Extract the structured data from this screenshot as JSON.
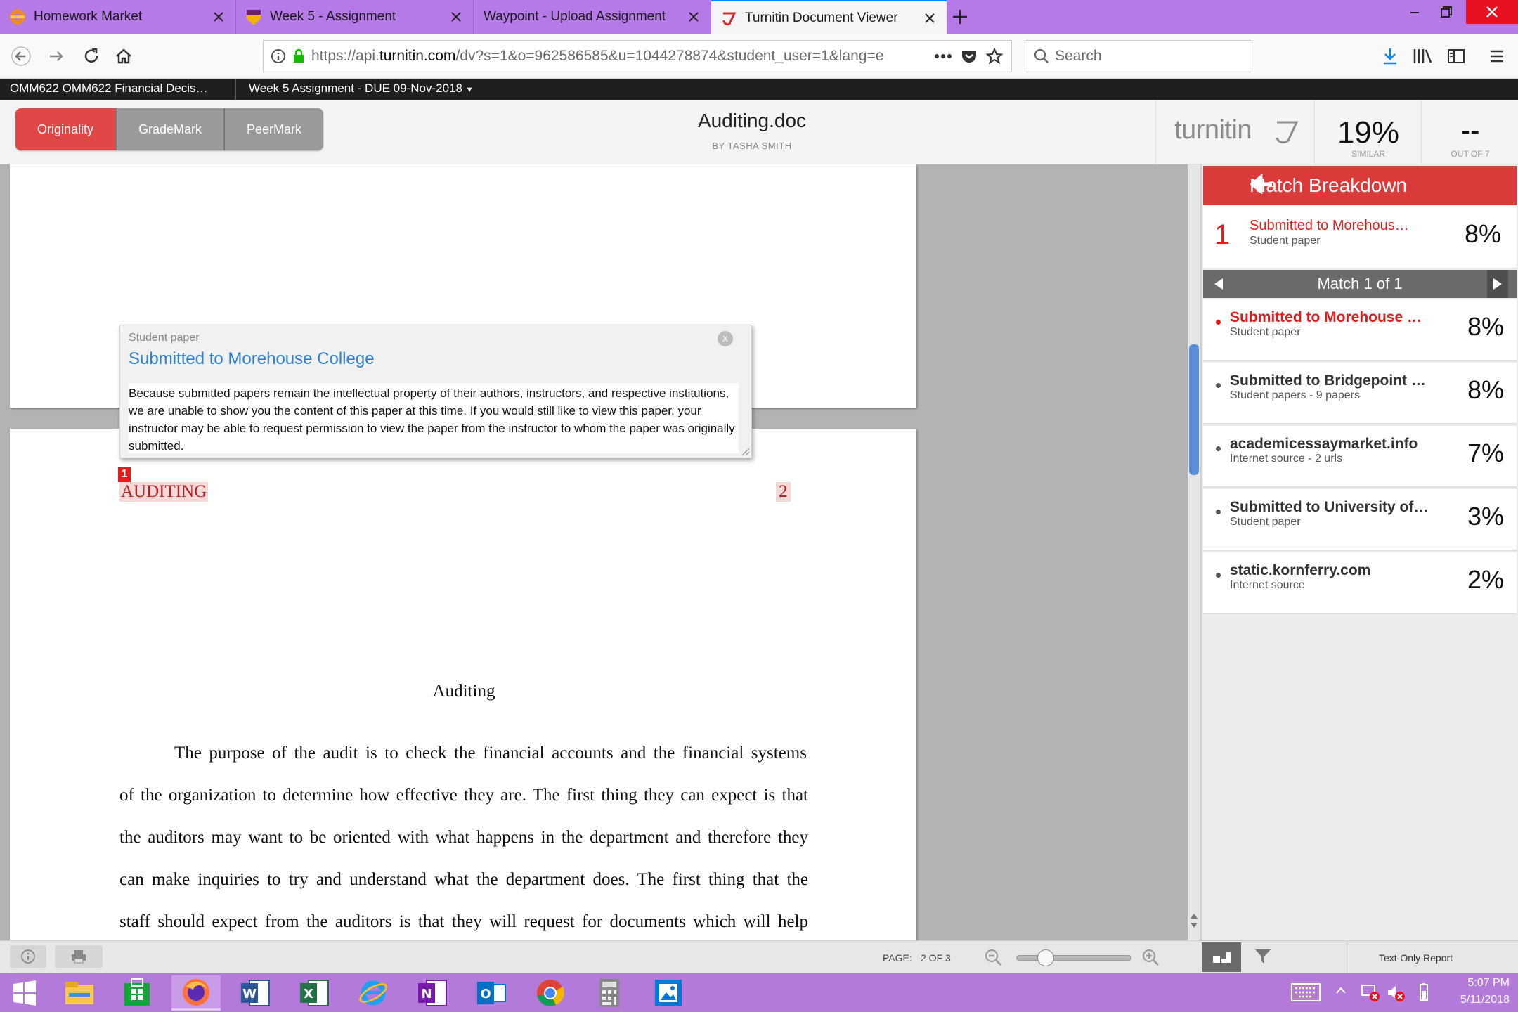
{
  "browser": {
    "tabs": [
      {
        "label": "Homework Market",
        "active": false
      },
      {
        "label": "Week 5 - Assignment",
        "active": false
      },
      {
        "label": "Waypoint - Upload Assignment",
        "active": false
      },
      {
        "label": "Turnitin Document Viewer",
        "active": true
      }
    ],
    "url_prefix": "https://api.",
    "url_domain": "turnitin.com",
    "url_rest": "/dv?s=1&o=962586585&u=1044278874&student_user=1&lang=e",
    "search_placeholder": "Search"
  },
  "lms": {
    "course": "OMM622 OMM622 Financial Decis…",
    "assignment": "Week 5 Assignment - DUE 09-Nov-2018"
  },
  "turnitin": {
    "modes": [
      "Originality",
      "GradeMark",
      "PeerMark"
    ],
    "active_mode": "Originality",
    "doc_title": "Auditing.doc",
    "doc_author": "BY TASHA SMITH",
    "logo": "turnitin",
    "similarity": "19%",
    "similarity_label": "SIMILAR",
    "grade": "--",
    "grade_label": "OUT OF 7"
  },
  "document": {
    "match_marker": "1",
    "header_word": "AUDITING",
    "page_number": "2",
    "heading": "Auditing",
    "lines": [
      "The purpose of the audit is to check the financial accounts and the financial systems",
      "of the organization to determine how effective they are. The first thing they can expect is that",
      "the auditors may want to be oriented with what happens in the department and therefore they",
      "can make inquiries to try and understand what the department does. The first thing that the",
      "staff should expect from the auditors is that they will request for documents which will help"
    ]
  },
  "popup": {
    "source_type": "Student paper",
    "source_name": "Submitted to Morehouse College",
    "close": "x",
    "body": "Because submitted papers remain the intellectual property of their authors, instructors, and respective institutions, we are unable to show you the content of this paper at this time. If you would still like to view this paper, your instructor may be able to request permission to view the paper from the instructor to whom the paper was originally submitted."
  },
  "doc_toolbar": {
    "page_label": "PAGE:",
    "page_value": "2 OF 3"
  },
  "match_breakdown": {
    "title": "Match Breakdown",
    "current": {
      "number": "1",
      "name": "Submitted to Morehous…",
      "type": "Student paper",
      "pct": "8%"
    },
    "nav_label": "Match 1 of 1",
    "sources": [
      {
        "name": "Submitted to Morehouse …",
        "type": "Student paper",
        "pct": "8%",
        "selected": true
      },
      {
        "name": "Submitted to Bridgepoint …",
        "type": "Student papers - 9 papers",
        "pct": "8%",
        "selected": false
      },
      {
        "name": "academicessaymarket.info",
        "type": "Internet source - 2 urls",
        "pct": "7%",
        "selected": false
      },
      {
        "name": "Submitted to University of…",
        "type": "Student paper",
        "pct": "3%",
        "selected": false
      },
      {
        "name": "static.kornferry.com",
        "type": "Internet source",
        "pct": "2%",
        "selected": false
      }
    ],
    "text_only_report": "Text-Only Report"
  },
  "taskbar": {
    "apps": [
      "start-icon",
      "file-explorer-icon",
      "store-icon",
      "firefox-icon",
      "word-icon",
      "excel-icon",
      "internet-explorer-icon",
      "onenote-icon",
      "outlook-icon",
      "chrome-icon",
      "calculator-icon",
      "photos-icon"
    ],
    "time": "5:07 PM",
    "date": "5/11/2018"
  },
  "colors": {
    "accent_red": "#d93a3a",
    "match_red": "#e21b1b",
    "taskbar": "#b37ad9",
    "link_blue": "#2d7fd3"
  }
}
